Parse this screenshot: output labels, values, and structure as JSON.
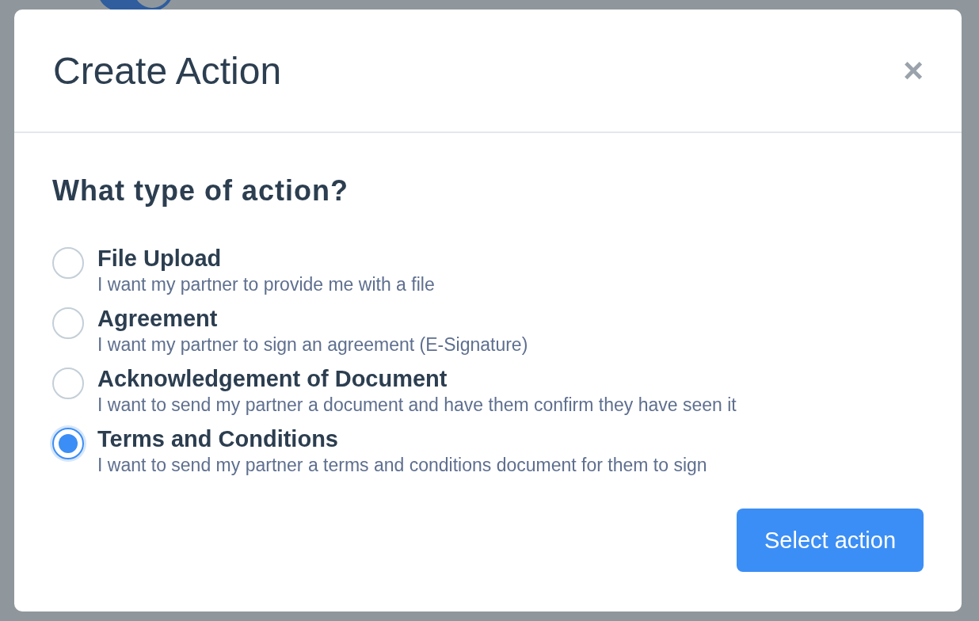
{
  "background": {
    "toggle": {
      "on": true
    }
  },
  "dialog": {
    "title": "Create Action",
    "close": "×"
  },
  "question": "What type of action?",
  "options": [
    {
      "label": "File Upload",
      "description": "I want my partner to provide me with a file",
      "selected": false
    },
    {
      "label": "Agreement",
      "description": "I want my partner to sign an agreement (E-Signature)",
      "selected": false
    },
    {
      "label": "Acknowledgement of Document",
      "description": "I want to send my partner a document and have them confirm they have seen it",
      "selected": false
    },
    {
      "label": "Terms and Conditions",
      "description": "I want to send my partner a terms and conditions document for them to sign",
      "selected": true
    }
  ],
  "button": "Select action"
}
